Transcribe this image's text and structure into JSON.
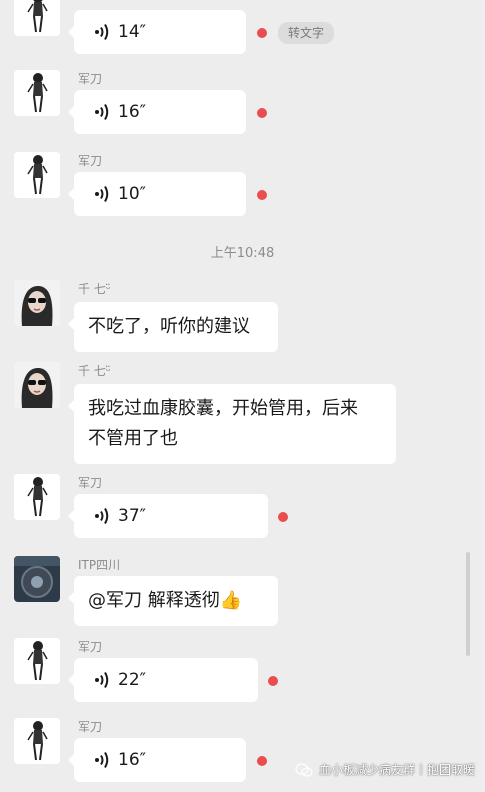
{
  "messages": [
    {
      "sender": "",
      "duration": "14″",
      "avatar": "junda"
    },
    {
      "sender": "军刀",
      "duration": "16″",
      "avatar": "junda"
    },
    {
      "sender": "军刀",
      "duration": "10″",
      "avatar": "junda"
    }
  ],
  "timestamp": "上午10:48",
  "text_messages": [
    {
      "sender": "千 七ᵕ̈",
      "text": "不吃了，听你的建议"
    },
    {
      "sender": "千 七ᵕ̈",
      "text_line1": "我吃过血康胶囊，开始管用，后来",
      "text_line2": "不管用了也"
    }
  ],
  "later_messages": [
    {
      "sender": "军刀",
      "duration": "37″"
    },
    {
      "sender": "ITP四川",
      "text": "@军刀  解释透彻👍"
    },
    {
      "sender": "军刀",
      "duration": "22″"
    },
    {
      "sender": "军刀",
      "duration": "16″"
    }
  ],
  "convert_text": "转文字",
  "watermark": "血小板减少病友群丨抱团取暖",
  "colors": {
    "background": "#ededed",
    "bubble": "#ffffff",
    "unread_dot": "#e94d4d"
  }
}
